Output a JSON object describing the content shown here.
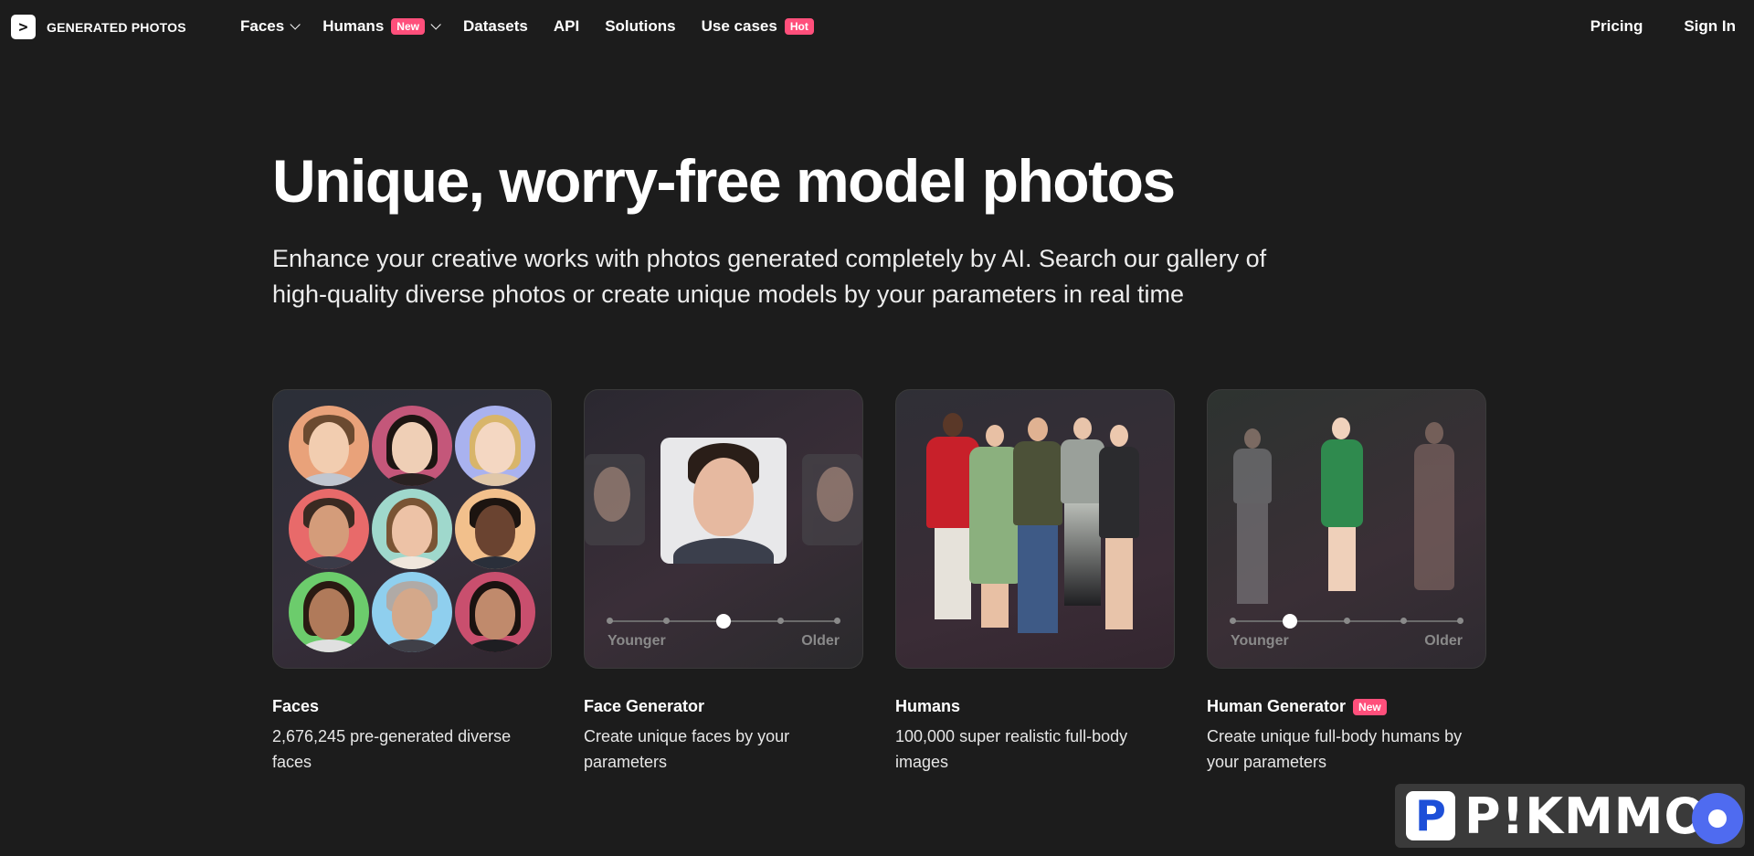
{
  "brand": {
    "name": "GENERATED PHOTOS",
    "mark": ">"
  },
  "nav": {
    "items": [
      {
        "label": "Faces",
        "dropdown": true,
        "badge": ""
      },
      {
        "label": "Humans",
        "dropdown": true,
        "badge": "New"
      },
      {
        "label": "Datasets",
        "dropdown": false,
        "badge": ""
      },
      {
        "label": "API",
        "dropdown": false,
        "badge": ""
      },
      {
        "label": "Solutions",
        "dropdown": false,
        "badge": ""
      },
      {
        "label": "Use cases",
        "dropdown": false,
        "badge": "Hot"
      }
    ],
    "pricing": "Pricing",
    "sign_in": "Sign In"
  },
  "hero": {
    "title": "Unique, worry-free model photos",
    "subtitle_line1": "Enhance your creative works with photos generated completely by AI. Search our gallery of",
    "subtitle_line2": "high-quality diverse photos or create unique models by your parameters in real time"
  },
  "cards": [
    {
      "title": "Faces",
      "badge": "",
      "desc_line1": "2,676,245 pre-generated diverse",
      "desc_line2": "faces"
    },
    {
      "title": "Face Generator",
      "badge": "",
      "desc_line1": "Create unique faces by your",
      "desc_line2": "parameters",
      "slider": {
        "min_label": "Younger",
        "max_label": "Older",
        "level": 0.5
      }
    },
    {
      "title": "Humans",
      "badge": "",
      "desc_line1": "100,000 super realistic full-body",
      "desc_line2": "images"
    },
    {
      "title": "Human Generator",
      "badge": "New",
      "desc_line1": "Create unique full-body humans by",
      "desc_line2": "your parameters",
      "slider": {
        "min_label": "Younger",
        "max_label": "Older",
        "level": 0.25
      }
    }
  ],
  "watermark": {
    "text": "P!KMMO"
  },
  "colors": {
    "background": "#1c1c1c",
    "badge": "#ff4f7b",
    "chat": "#4f6bf0"
  },
  "icons": [
    "logo-icon",
    "chevron-down-icon",
    "chat-icon"
  ]
}
